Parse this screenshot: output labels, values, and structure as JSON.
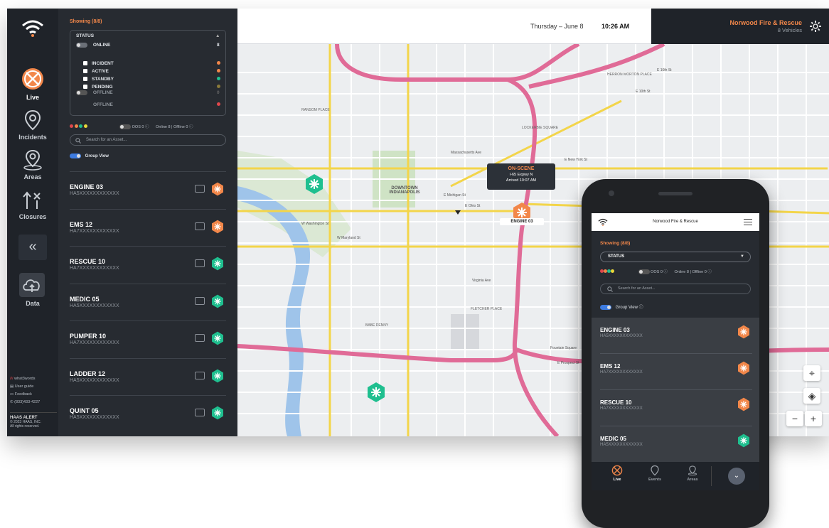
{
  "nav": {
    "items": [
      {
        "label": "Live",
        "icon": "live-icon"
      },
      {
        "label": "Incidents",
        "icon": "incident-pin-icon"
      },
      {
        "label": "Areas",
        "icon": "area-pin-icon"
      },
      {
        "label": "Closures",
        "icon": "closures-icon"
      }
    ],
    "collapse_label": "«",
    "data_label": "Data",
    "footer": {
      "what3words": "what3words",
      "user_guide": "User guide",
      "feedback": "Feedback",
      "phone": "(833)433-4227",
      "brand": "HAAS ALERT",
      "copyright": "© 2023 HAAS, INC.",
      "rights": "All rights reserved."
    }
  },
  "panel": {
    "showing": "Showing (8/8)",
    "status": {
      "title": "STATUS",
      "online_label": "ONLINE",
      "online_count": "8",
      "options": [
        {
          "label": "INCIDENT",
          "color": "#f2874a"
        },
        {
          "label": "ACTIVE",
          "color": "#f2874a"
        },
        {
          "label": "STANDBY",
          "color": "#1fbf8f"
        },
        {
          "label": "PENDING",
          "color": "#8a7a3a"
        }
      ],
      "offline_label": "OFFLINE",
      "offline_count": "0",
      "offline_sub": "OFFLINE"
    },
    "legend": {
      "oos": "OOS 0",
      "counts": "Online 8 | Offline 0"
    },
    "search_placeholder": "Search for an Asset...",
    "group_view": "Group View",
    "assets": [
      {
        "name": "ENGINE 03",
        "id": "HA5XXXXXXXXXXXX",
        "color": "#f2874a"
      },
      {
        "name": "EMS 12",
        "id": "HA7XXXXXXXXXXXX",
        "color": "#f2874a"
      },
      {
        "name": "RESCUE 10",
        "id": "HA7XXXXXXXXXXXX",
        "color": "#1fbf8f"
      },
      {
        "name": "MEDIC 05",
        "id": "HA5XXXXXXXXXXXX",
        "color": "#1fbf8f"
      },
      {
        "name": "PUMPER 10",
        "id": "HA7XXXXXXXXXXXX",
        "color": "#1fbf8f"
      },
      {
        "name": "LADDER 12",
        "id": "HA5XXXXXXXXXXXX",
        "color": "#1fbf8f"
      },
      {
        "name": "QUINT 05",
        "id": "HA5XXXXXXXXXXXX",
        "color": "#1fbf8f"
      }
    ]
  },
  "header": {
    "date": "Thursday – June 8",
    "time": "10:26 AM",
    "org_name": "Norwood Fire & Rescue",
    "org_sub": "8 Vehicles"
  },
  "map": {
    "tooltip_title": "ON-SCENE",
    "tooltip_line1": "I-65 Expwy N",
    "tooltip_line2": "Arrived 10:07 AM",
    "marker_label": "ENGINE 03",
    "labels": [
      "DOWNTOWN INDIANAPOLIS",
      "RANSOM PLACE",
      "LOCKERBIE SQUARE",
      "FLETCHER PLACE",
      "E Michigan St",
      "E Ohio St",
      "W Washington St",
      "W Maryland St",
      "Massachusetts Ave",
      "Virginia Ave",
      "E 16th St",
      "E 10th St",
      "E New York St",
      "Fountain Square",
      "E Prospect St",
      "BABE DENNY",
      "HERRON MORTON PLACE"
    ],
    "zoom_in": "+",
    "zoom_out": "−"
  },
  "phone": {
    "title": "Norwood Fire & Rescue",
    "showing": "Showing (8/8)",
    "status": "STATUS",
    "oos": "OOS 0",
    "counts": "Online 8 | Offline 0",
    "search_placeholder": "Search for an Asset...",
    "group_view": "Group View",
    "assets": [
      {
        "name": "ENGINE 03",
        "id": "HA5XXXXXXXXXXXX",
        "color": "#f2874a"
      },
      {
        "name": "EMS 12",
        "id": "HA7XXXXXXXXXXXX",
        "color": "#f2874a"
      },
      {
        "name": "RESCUE 10",
        "id": "HA7XXXXXXXXXXXX",
        "color": "#f2874a"
      },
      {
        "name": "MEDIC 05",
        "id": "HA5XXXXXXXXXXXX",
        "color": "#1fbf8f"
      }
    ],
    "tabs": [
      "Live",
      "Events",
      "Areas"
    ]
  },
  "colors": {
    "accent": "#f2874a",
    "standby": "#1fbf8f",
    "dark": "#1f2329"
  }
}
